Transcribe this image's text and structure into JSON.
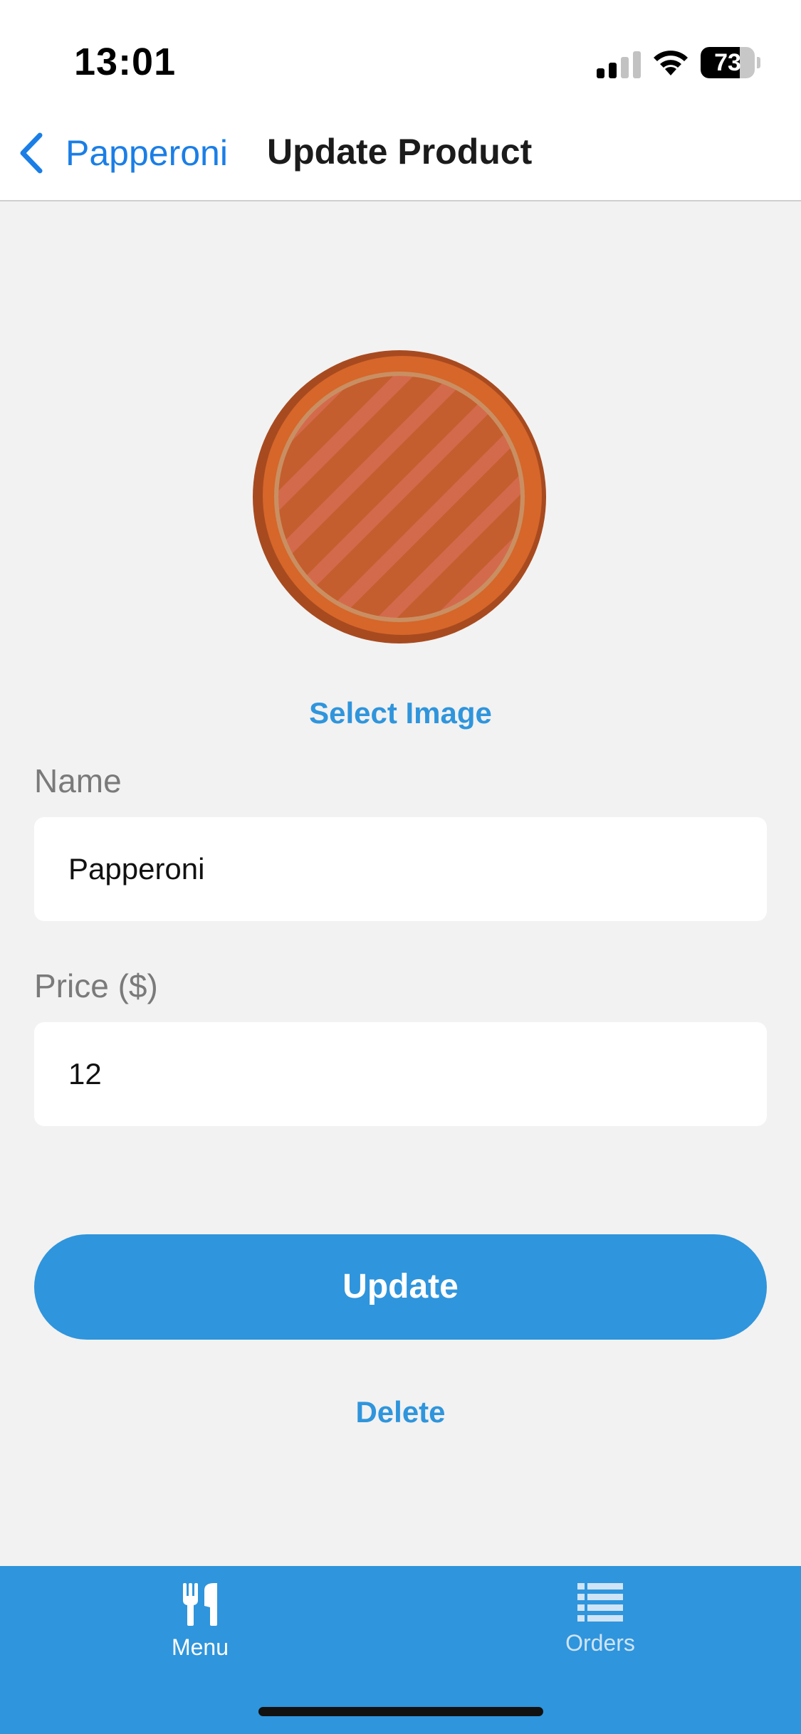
{
  "status_bar": {
    "time": "13:01",
    "battery_level": "73",
    "battery_fraction": 0.73
  },
  "nav": {
    "back_label": "Papperoni",
    "title": "Update Product"
  },
  "product": {
    "image_icon": "pizza-image",
    "select_image_label": "Select Image"
  },
  "form": {
    "name_label": "Name",
    "name_value": "Papperoni",
    "price_label": "Price ($)",
    "price_value": "12"
  },
  "actions": {
    "update_label": "Update",
    "delete_label": "Delete"
  },
  "tab_bar": {
    "items": [
      {
        "label": "Menu",
        "icon": "fork-knife-icon",
        "active": true
      },
      {
        "label": "Orders",
        "icon": "list-icon",
        "active": false
      }
    ]
  },
  "colors": {
    "accent": "#2f95dc",
    "nav_link": "#1a7ee6",
    "background": "#f2f2f2"
  }
}
